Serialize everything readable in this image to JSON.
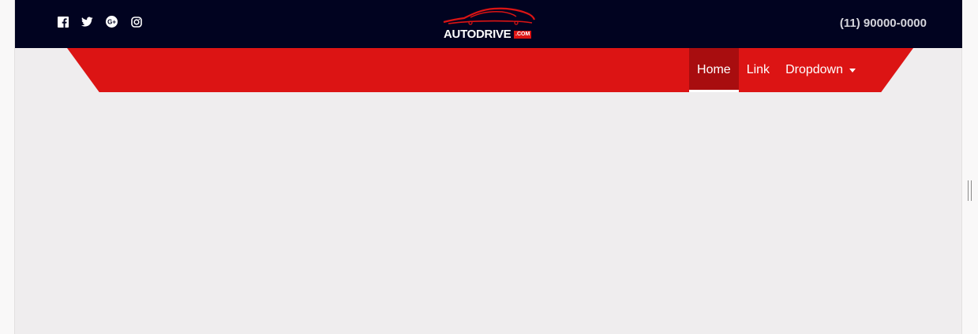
{
  "header": {
    "social_icons": [
      "facebook-icon",
      "twitter-icon",
      "google-plus-icon",
      "instagram-icon"
    ],
    "logo": {
      "brand": "AUTODRIVE",
      "suffix": ".COM"
    },
    "phone": "(11) 90000-0000"
  },
  "nav": {
    "items": [
      {
        "label": "Home",
        "active": true
      },
      {
        "label": "Link",
        "active": false
      },
      {
        "label": "Dropdown",
        "active": false
      }
    ]
  },
  "colors": {
    "topbar": "#010320",
    "accent_red": "#dc1414",
    "active_red": "#a80d0f",
    "page_bg": "#efedee"
  }
}
